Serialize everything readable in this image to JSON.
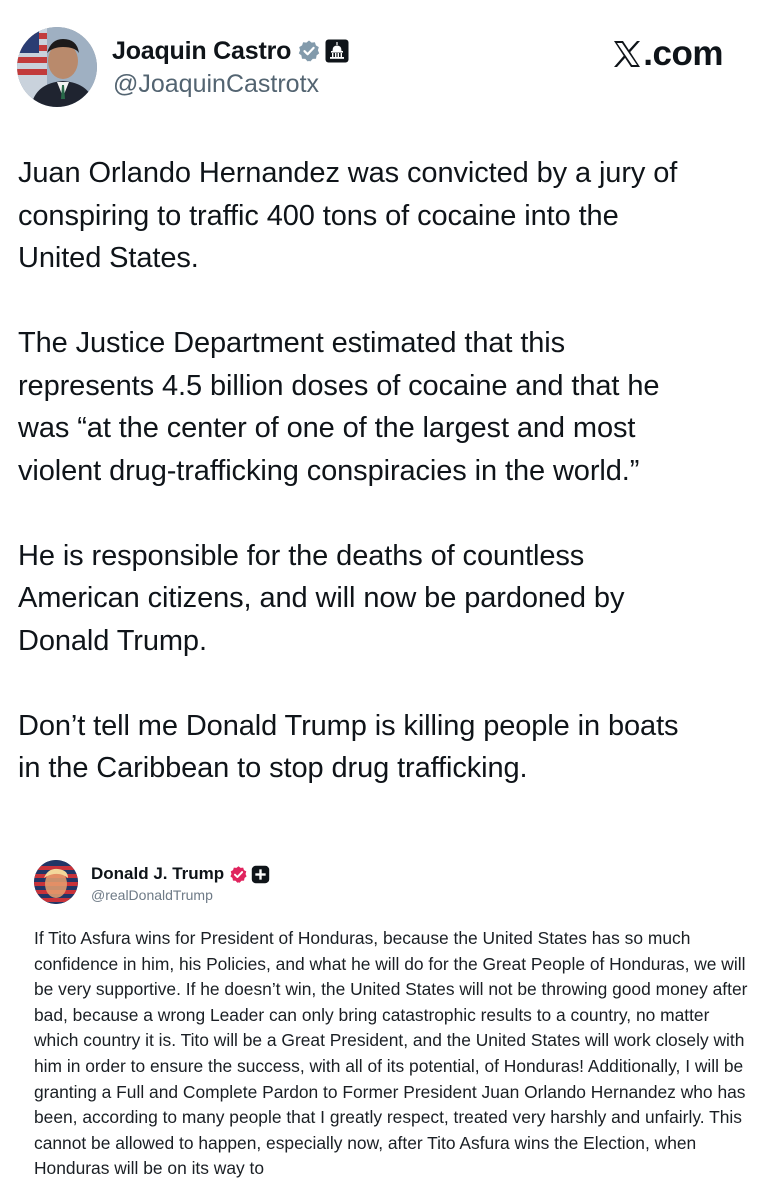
{
  "header": {
    "display_name": "Joaquin Castro",
    "handle": "@JoaquinCastrotx",
    "site_label": ".com",
    "icons": {
      "avatar": "profile-photo",
      "verified": "verified-badge-icon",
      "affiliation": "capitol-building-icon",
      "site_logo": "x-logo-icon"
    }
  },
  "tweet": {
    "paragraphs": [
      "Juan Orlando Hernandez was convicted by a jury of\nconspiring to traffic 400 tons of cocaine into the\nUnited States.",
      "The Justice Department estimated that this\nrepresents 4.5 billion doses of cocaine and that he\nwas “at the center of one of the largest and most\nviolent drug-trafficking conspiracies in the world.”",
      "He is responsible for the deaths of countless\nAmerican citizens, and will now be pardoned by\nDonald Trump.",
      "Don’t tell me Donald Trump is killing people in boats\nin the Caribbean to stop drug trafficking."
    ]
  },
  "embedded_post": {
    "display_name": "Donald J. Trump",
    "handle": "@realDonaldTrump",
    "icons": {
      "avatar": "profile-photo",
      "verified": "verified-badge-icon",
      "extra": "plus-badge-icon"
    },
    "text": "If Tito Asfura wins for President of Honduras, because the United States has so much confidence in him, his Policies, and what he will do for the Great People of Honduras, we will be very supportive. If he doesn’t win, the United States will not be throwing good money after bad, because a wrong Leader can only bring catastrophic results to a country, no matter which country it is. Tito will be a Great President, and the United States will work closely with him in order to ensure the success, with all of its potential, of Honduras! Additionally, I will be granting a Full and Complete Pardon to Former President Juan Orlando Hernandez who has been, according to many people that I greatly respect, treated very harshly and unfairly. This cannot be allowed to happen, especially now, after Tito Asfura wins the Election, when Honduras will be on its way to"
  },
  "colors": {
    "text_primary": "#0f1419",
    "text_secondary": "#536471",
    "verified_badge": "#829aab",
    "trump_badge": "#e0245e"
  }
}
